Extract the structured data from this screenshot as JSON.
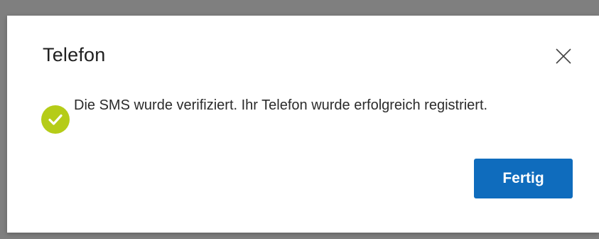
{
  "dialog": {
    "title": "Telefon",
    "close_icon": "close-icon",
    "status_icon": "check-circle-icon",
    "status_color": "#b5cc18",
    "message": "Die SMS wurde verifiziert. Ihr Telefon wurde erfolgreich registriert.",
    "primary_button_label": "Fertig",
    "primary_button_color": "#0f6cbd"
  }
}
